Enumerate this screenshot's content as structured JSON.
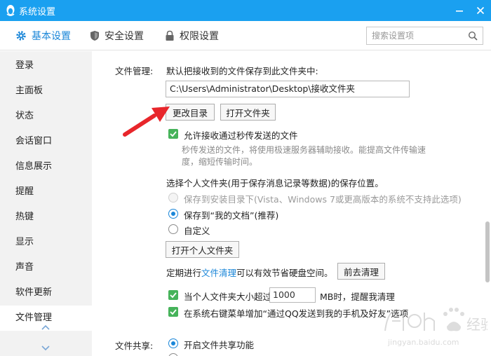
{
  "titlebar": {
    "title": "系统设置"
  },
  "tabs": [
    {
      "label": "基本设置",
      "icon": "gear-icon",
      "active": true
    },
    {
      "label": "安全设置",
      "icon": "shield-icon",
      "active": false
    },
    {
      "label": "权限设置",
      "icon": "lock-icon",
      "active": false
    }
  ],
  "search": {
    "placeholder": "搜索设置项"
  },
  "sidebar": {
    "items": [
      {
        "label": "登录"
      },
      {
        "label": "主面板"
      },
      {
        "label": "状态"
      },
      {
        "label": "会话窗口"
      },
      {
        "label": "信息展示"
      },
      {
        "label": "提醒"
      },
      {
        "label": "热键"
      },
      {
        "label": "显示"
      },
      {
        "label": "声音"
      },
      {
        "label": "软件更新"
      },
      {
        "label": "文件管理"
      }
    ],
    "active_index": 10
  },
  "file_mgmt": {
    "section_label": "文件管理:",
    "default_save_label": "默认把接收到的文件保存到此文件夹中:",
    "path_value": "C:\\Users\\Administrator\\Desktop\\接收文件夹",
    "change_dir_button": "更改目录",
    "open_folder_button": "打开文件夹",
    "allow_flash_label": "允许接收通过秒传发送的文件",
    "flash_hint_line1": "秒传发送的文件，将使用极速服务器辅助接收。能提高文件传输速",
    "flash_hint_line2": "度，缩短传输时间。",
    "personal_folder_label": "选择个人文件夹(用于保存消息记录等数据)的保存位置。",
    "radio_install_dir": "保存到安装目录下(Vista、Windows 7或更高版本的系统不支持此选项)",
    "radio_my_docs": "保存到“我的文档”(推荐)",
    "radio_custom": "自定义",
    "open_personal_button": "打开个人文件夹",
    "cleanup_prefix": "定期进行",
    "cleanup_link": "文件清理",
    "cleanup_suffix": "可以有效节省硬盘空间。",
    "cleanup_button": "前去清理",
    "size_alert_prefix": "当个人文件夹大小超过",
    "size_alert_value": "1000",
    "size_alert_suffix": "MB时，提醒我清理",
    "context_menu_label": "在系统右键菜单增加“通过QQ发送到我的手机及好友”选项"
  },
  "file_share": {
    "section_label": "文件共享:",
    "enable_label": "开启文件共享功能"
  },
  "watermark": {
    "text_cn": "经验",
    "text_en": "jingyan.baidu.com"
  },
  "colors": {
    "titlebar": "#1aa0f0",
    "accent": "#1a86d8",
    "check_green": "#46b35a",
    "arrow_red": "#e8262b"
  }
}
